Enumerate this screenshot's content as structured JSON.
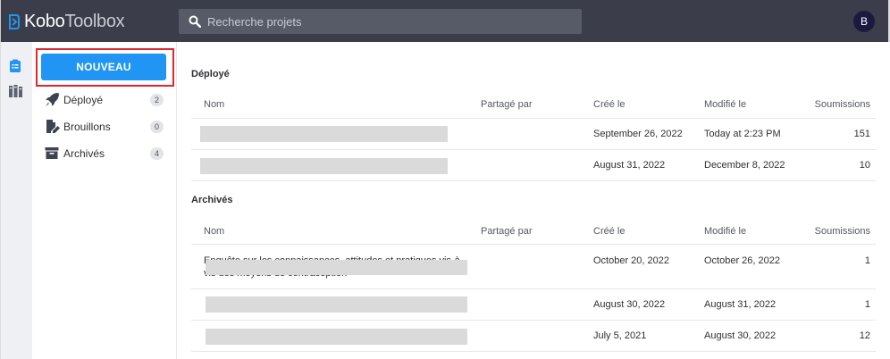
{
  "app": {
    "logo_kobo": "Kobo",
    "logo_toolbox": "Toolbox",
    "logo_icon": "kobo-logo-icon"
  },
  "search": {
    "placeholder": "Recherche projets",
    "icon": "search-icon"
  },
  "user": {
    "avatar_initial": "B",
    "avatar_color": "#1a1a40"
  },
  "rail": {
    "items": [
      {
        "icon": "clipboard-icon",
        "color": "#2095f3"
      },
      {
        "icon": "library-icon",
        "color": "#5d6271"
      }
    ]
  },
  "sidebar": {
    "new_button_label": "NOUVEAU",
    "items": [
      {
        "label": "Déployé",
        "count": "2",
        "icon": "rocket-icon"
      },
      {
        "label": "Brouillons",
        "count": "0",
        "icon": "draft-edit-icon"
      },
      {
        "label": "Archivés",
        "count": "4",
        "icon": "archive-box-icon"
      }
    ]
  },
  "sections": [
    {
      "title": "Déployé",
      "headers": {
        "nom": "Nom",
        "partage": "Partagé par",
        "cree": "Créé le",
        "modifie": "Modifié le",
        "soumissions": "Soumissions"
      },
      "rows": [
        {
          "name": "",
          "cree": "September 26, 2022",
          "modifie": "Today at 2:23 PM",
          "soumissions": "151"
        },
        {
          "name": "",
          "cree": "August 31, 2022",
          "modifie": "December 8, 2022",
          "soumissions": "10"
        }
      ]
    },
    {
      "title": "Archivés",
      "headers": {
        "nom": "Nom",
        "partage": "Partagé par",
        "cree": "Créé le",
        "modifie": "Modifié le",
        "soumissions": "Soumissions"
      },
      "rows": [
        {
          "name": "Enquête sur les connaissances, attitudes et pratiques vis-à-vis des moyens de contraception",
          "cree": "October 20, 2022",
          "modifie": "October 26, 2022",
          "soumissions": "1"
        },
        {
          "name": "",
          "cree": "August 30, 2022",
          "modifie": "August 31, 2022",
          "soumissions": "1"
        },
        {
          "name": "",
          "cree": "July 5, 2021",
          "modifie": "August 30, 2022",
          "soumissions": "12"
        }
      ]
    }
  ],
  "colors": {
    "topbar": "#3b3e4a",
    "accent": "#2095f3",
    "highlight": "#e1262e"
  }
}
